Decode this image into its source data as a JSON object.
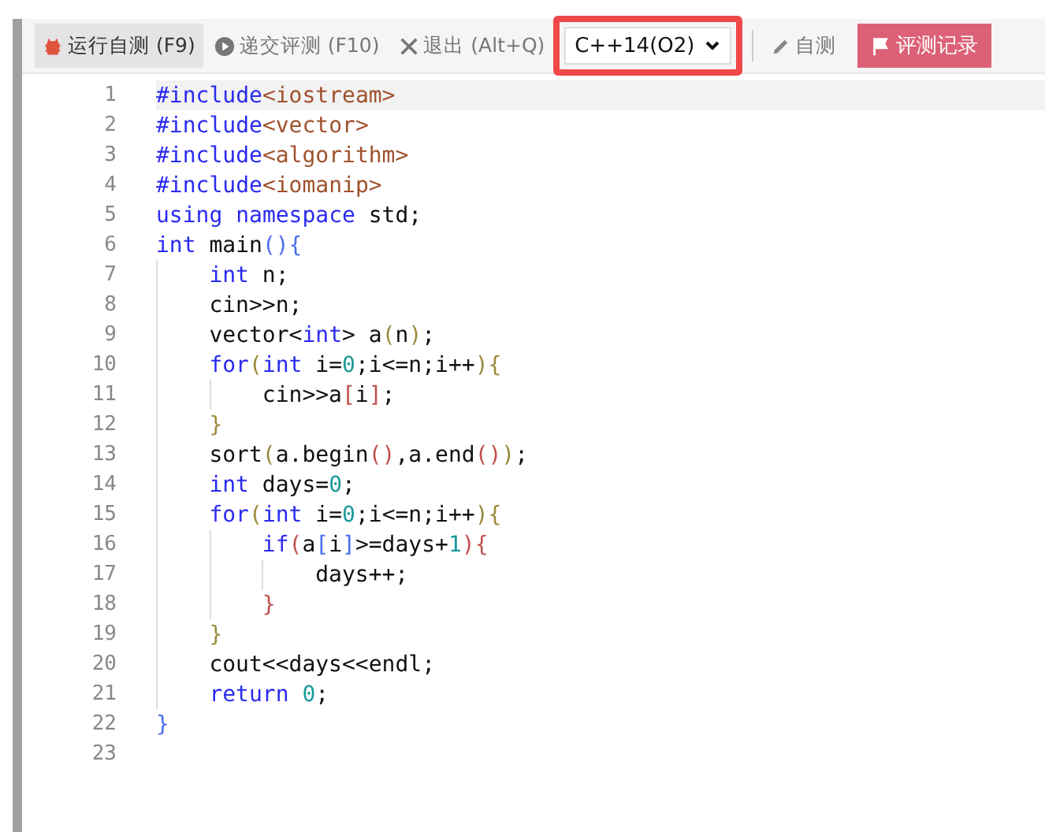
{
  "toolbar": {
    "buttons": [
      {
        "label": "运行自测 (F9)",
        "kind": "bug",
        "selected": true
      },
      {
        "label": "递交评测 (F10)",
        "kind": "play",
        "selected": false
      },
      {
        "label": "退出 (Alt+Q)",
        "kind": "close",
        "selected": false
      }
    ],
    "language_select": {
      "value": "C++14(O2)",
      "highlighted": true
    },
    "self_test": {
      "label": "自测"
    },
    "records_button": {
      "label": "评测记录"
    }
  },
  "editor": {
    "lines": [
      {
        "number": "1",
        "active": true,
        "tokens": [
          {
            "text": "#include",
            "kind": "keyword"
          },
          {
            "text": "<iostream>",
            "kind": "header"
          }
        ]
      },
      {
        "number": "2",
        "active": false,
        "tokens": [
          {
            "text": "#include",
            "kind": "keyword"
          },
          {
            "text": "<vector>",
            "kind": "header"
          }
        ]
      },
      {
        "number": "3",
        "active": false,
        "tokens": [
          {
            "text": "#include",
            "kind": "keyword"
          },
          {
            "text": "<algorithm>",
            "kind": "header"
          }
        ]
      },
      {
        "number": "4",
        "active": false,
        "tokens": [
          {
            "text": "#include",
            "kind": "keyword"
          },
          {
            "text": "<iomanip>",
            "kind": "header"
          }
        ]
      },
      {
        "number": "5",
        "active": false,
        "tokens": [
          {
            "text": "using",
            "kind": "keyword"
          },
          {
            "text": " namespace",
            "kind": "keyword"
          },
          {
            "text": " std;",
            "kind": "plain"
          }
        ]
      },
      {
        "number": "6",
        "active": false,
        "tokens": [
          {
            "text": "int",
            "kind": "keyword"
          },
          {
            "text": " main",
            "kind": "plain"
          },
          {
            "text": "(){",
            "kind": "bracket1"
          }
        ]
      },
      {
        "number": "7",
        "active": false,
        "tokens": [
          {
            "text": "    int",
            "kind": "keyword"
          },
          {
            "text": " n;",
            "kind": "plain"
          }
        ]
      },
      {
        "number": "8",
        "active": false,
        "tokens": [
          {
            "text": "    cin>>n;",
            "kind": "plain"
          }
        ]
      },
      {
        "number": "9",
        "active": false,
        "tokens": [
          {
            "text": "    vector<",
            "kind": "plain"
          },
          {
            "text": "int",
            "kind": "keyword"
          },
          {
            "text": "> a",
            "kind": "plain"
          },
          {
            "text": "(",
            "kind": "bracket2"
          },
          {
            "text": "n",
            "kind": "plain"
          },
          {
            "text": ")",
            "kind": "bracket2"
          },
          {
            "text": ";",
            "kind": "plain"
          }
        ]
      },
      {
        "number": "10",
        "active": false,
        "tokens": [
          {
            "text": "    for",
            "kind": "keyword"
          },
          {
            "text": "(",
            "kind": "bracket2"
          },
          {
            "text": "int",
            "kind": "keyword"
          },
          {
            "text": " i=",
            "kind": "plain"
          },
          {
            "text": "0",
            "kind": "number"
          },
          {
            "text": ";i<=n;i++",
            "kind": "plain"
          },
          {
            "text": "){",
            "kind": "bracket2"
          }
        ]
      },
      {
        "number": "11",
        "active": false,
        "tokens": [
          {
            "text": "        cin>>a",
            "kind": "plain"
          },
          {
            "text": "[",
            "kind": "bracket3"
          },
          {
            "text": "i",
            "kind": "plain"
          },
          {
            "text": "]",
            "kind": "bracket3"
          },
          {
            "text": ";",
            "kind": "plain"
          }
        ]
      },
      {
        "number": "12",
        "active": false,
        "tokens": [
          {
            "text": "    }",
            "kind": "bracket2"
          }
        ]
      },
      {
        "number": "13",
        "active": false,
        "tokens": [
          {
            "text": "    sort",
            "kind": "plain"
          },
          {
            "text": "(",
            "kind": "bracket2"
          },
          {
            "text": "a.begin",
            "kind": "plain"
          },
          {
            "text": "()",
            "kind": "bracket3"
          },
          {
            "text": ",a.end",
            "kind": "plain"
          },
          {
            "text": "()",
            "kind": "bracket3"
          },
          {
            "text": ")",
            "kind": "bracket2"
          },
          {
            "text": ";",
            "kind": "plain"
          }
        ]
      },
      {
        "number": "14",
        "active": false,
        "tokens": [
          {
            "text": "    int",
            "kind": "keyword"
          },
          {
            "text": " days=",
            "kind": "plain"
          },
          {
            "text": "0",
            "kind": "number"
          },
          {
            "text": ";",
            "kind": "plain"
          }
        ]
      },
      {
        "number": "15",
        "active": false,
        "tokens": [
          {
            "text": "    for",
            "kind": "keyword"
          },
          {
            "text": "(",
            "kind": "bracket2"
          },
          {
            "text": "int",
            "kind": "keyword"
          },
          {
            "text": " i=",
            "kind": "plain"
          },
          {
            "text": "0",
            "kind": "number"
          },
          {
            "text": ";i<=n;i++",
            "kind": "plain"
          },
          {
            "text": "){",
            "kind": "bracket2"
          }
        ]
      },
      {
        "number": "16",
        "active": false,
        "tokens": [
          {
            "text": "        if",
            "kind": "keyword"
          },
          {
            "text": "(",
            "kind": "bracket3"
          },
          {
            "text": "a",
            "kind": "plain"
          },
          {
            "text": "[",
            "kind": "bracket1"
          },
          {
            "text": "i",
            "kind": "plain"
          },
          {
            "text": "]",
            "kind": "bracket1"
          },
          {
            "text": ">=days+",
            "kind": "plain"
          },
          {
            "text": "1",
            "kind": "number"
          },
          {
            "text": "){",
            "kind": "bracket3"
          }
        ]
      },
      {
        "number": "17",
        "active": false,
        "tokens": [
          {
            "text": "            days++;",
            "kind": "plain"
          }
        ]
      },
      {
        "number": "18",
        "active": false,
        "tokens": [
          {
            "text": "        }",
            "kind": "bracket3"
          }
        ]
      },
      {
        "number": "19",
        "active": false,
        "tokens": [
          {
            "text": "    }",
            "kind": "bracket2"
          }
        ]
      },
      {
        "number": "20",
        "active": false,
        "tokens": [
          {
            "text": "    cout<<days<<endl;",
            "kind": "plain"
          }
        ]
      },
      {
        "number": "21",
        "active": false,
        "tokens": [
          {
            "text": "    return",
            "kind": "keyword"
          },
          {
            "text": " 0",
            "kind": "number"
          },
          {
            "text": ";",
            "kind": "plain"
          }
        ]
      },
      {
        "number": "22",
        "active": false,
        "tokens": [
          {
            "text": "}",
            "kind": "bracket1"
          }
        ]
      },
      {
        "number": "23",
        "active": false
      }
    ]
  }
}
